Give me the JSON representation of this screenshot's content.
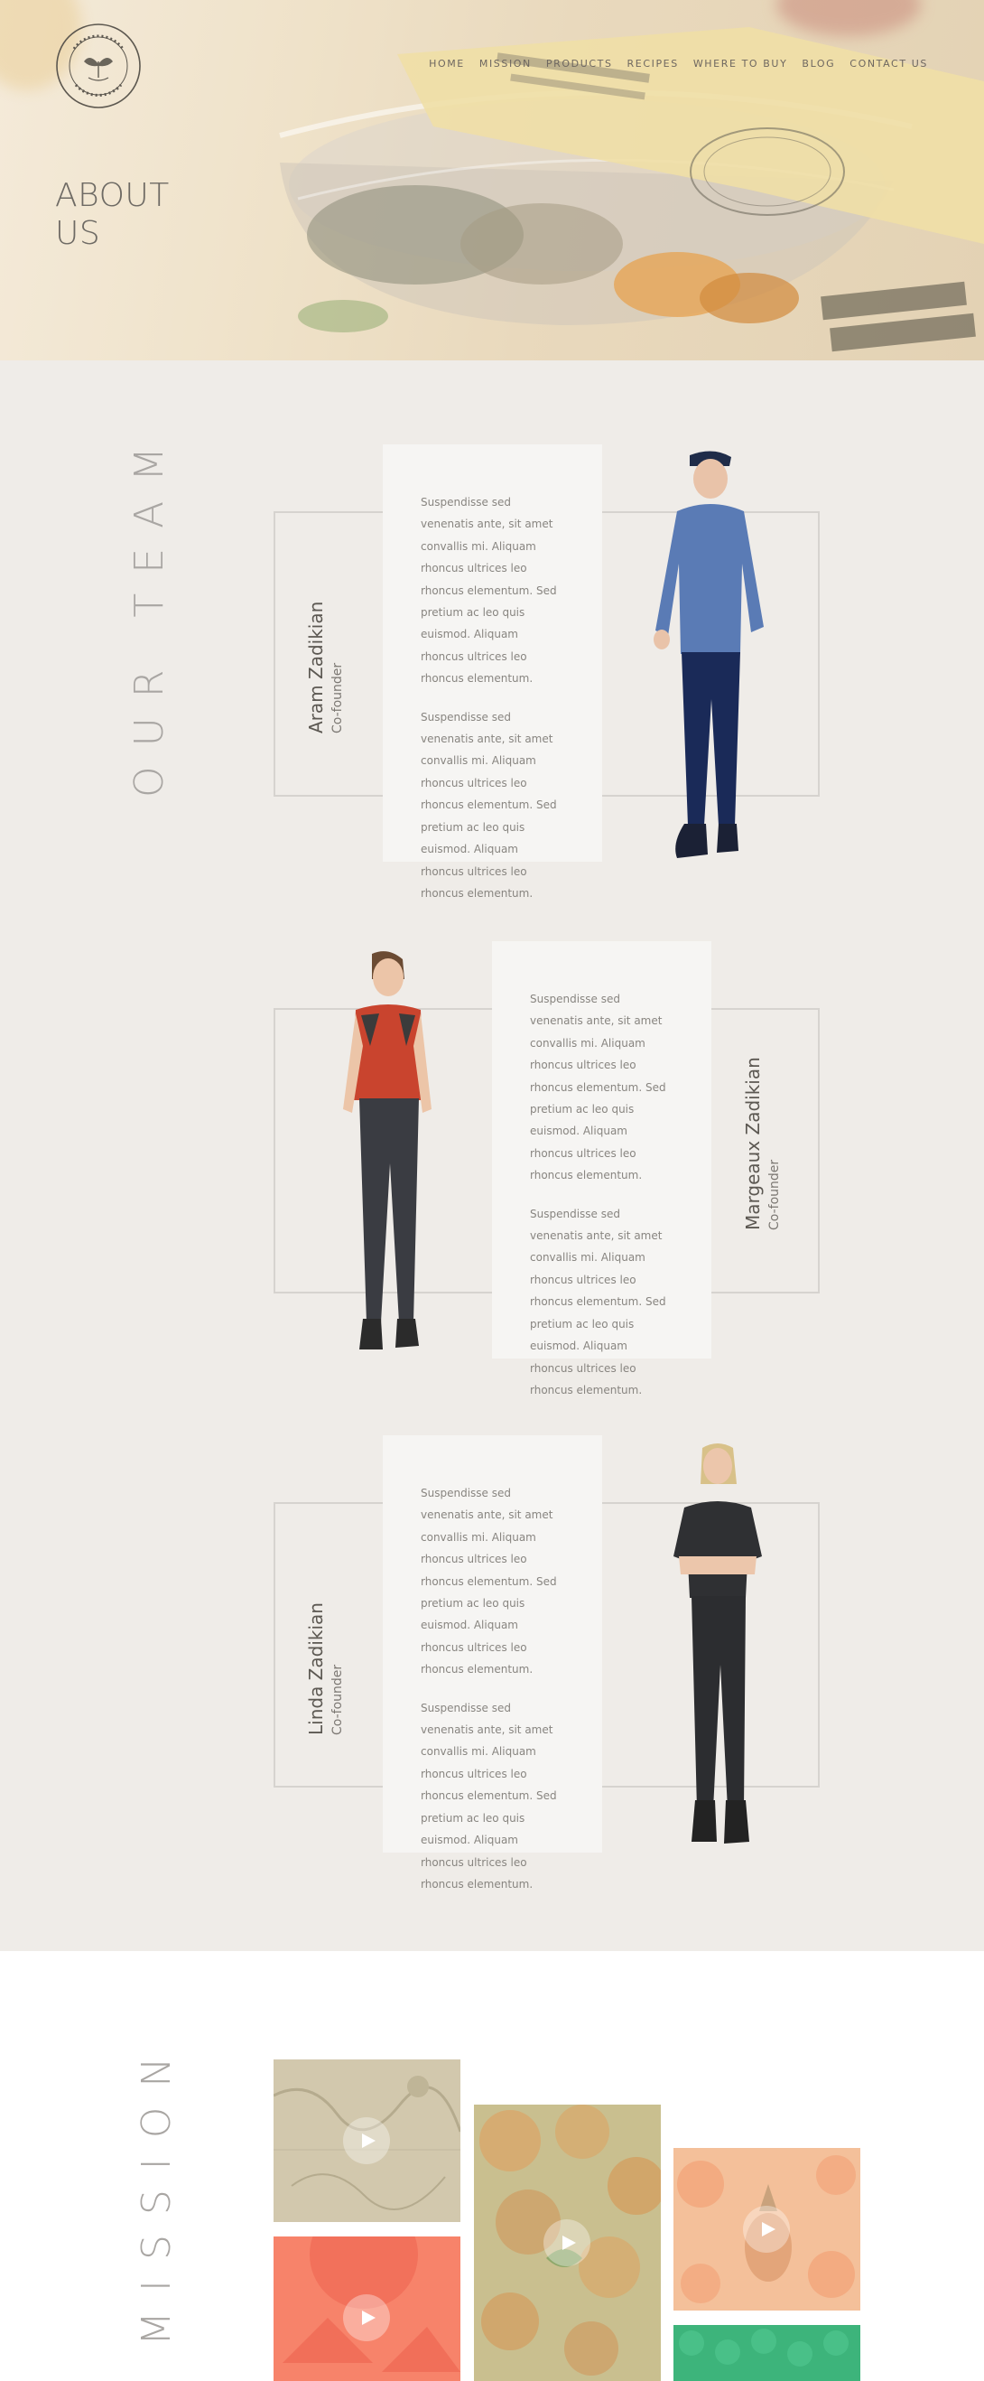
{
  "header": {
    "logo_alt": "Margeaux & Linda's Vegan Kitchen",
    "nav": [
      "HOME",
      "MISSION",
      "PRODUCTS",
      "RECIPES",
      "WHERE TO BUY",
      "BLOG",
      "CONTACT US"
    ],
    "page_title_line1": "ABOUT",
    "page_title_line2": "US"
  },
  "team": {
    "section_title": "OUR TEAM",
    "members": [
      {
        "name": "Aram Zadikian",
        "role": "Co-founder",
        "paragraph1": "Suspendisse sed venenatis ante, sit amet convallis mi. Aliquam rhoncus ultrices leo rhoncus elementum. Sed pretium ac leo quis euismod. Aliquam rhoncus ultrices leo rhoncus elementum.",
        "paragraph2": "Suspendisse sed venenatis ante, sit amet convallis mi. Aliquam rhoncus ultrices leo rhoncus elementum. Sed pretium ac leo quis euismod. Aliquam rhoncus ultrices leo rhoncus elementum."
      },
      {
        "name": "Margeaux Zadikian",
        "role": "Co-founder",
        "paragraph1": "Suspendisse sed venenatis ante, sit amet convallis mi. Aliquam rhoncus ultrices leo rhoncus elementum. Sed pretium ac leo quis euismod. Aliquam rhoncus ultrices leo rhoncus elementum.",
        "paragraph2": "Suspendisse sed venenatis ante, sit amet convallis mi. Aliquam rhoncus ultrices leo rhoncus elementum. Sed pretium ac leo quis euismod. Aliquam rhoncus ultrices leo rhoncus elementum."
      },
      {
        "name": "Linda Zadikian",
        "role": "Co-founder",
        "paragraph1": "Suspendisse sed venenatis ante, sit amet convallis mi. Aliquam rhoncus ultrices leo rhoncus elementum. Sed pretium ac leo quis euismod. Aliquam rhoncus ultrices leo rhoncus elementum.",
        "paragraph2": "Suspendisse sed venenatis ante, sit amet convallis mi. Aliquam rhoncus ultrices leo rhoncus elementum. Sed pretium ac leo quis euismod. Aliquam rhoncus ultrices leo rhoncus elementum."
      }
    ]
  },
  "mission": {
    "section_title": "MISSION",
    "videos": [
      {
        "theme": "map-texture",
        "color": "#d2c8ad",
        "icon": "play-icon"
      },
      {
        "theme": "citrus-slices",
        "color": "#c9bf8f",
        "icon": "play-icon"
      },
      {
        "theme": "pineapple-citrus",
        "color": "#f4c09a",
        "icon": "play-icon"
      },
      {
        "theme": "watermelon",
        "color": "#f7836a",
        "icon": "play-icon"
      },
      {
        "theme": "green-produce",
        "color": "#3db47b",
        "icon": "play-icon"
      }
    ]
  },
  "colors": {
    "team_bg": "#efece8",
    "card_bg": "#f6f5f3",
    "frame": "#d6d3cf",
    "title_gray": "#a9a6a3"
  }
}
